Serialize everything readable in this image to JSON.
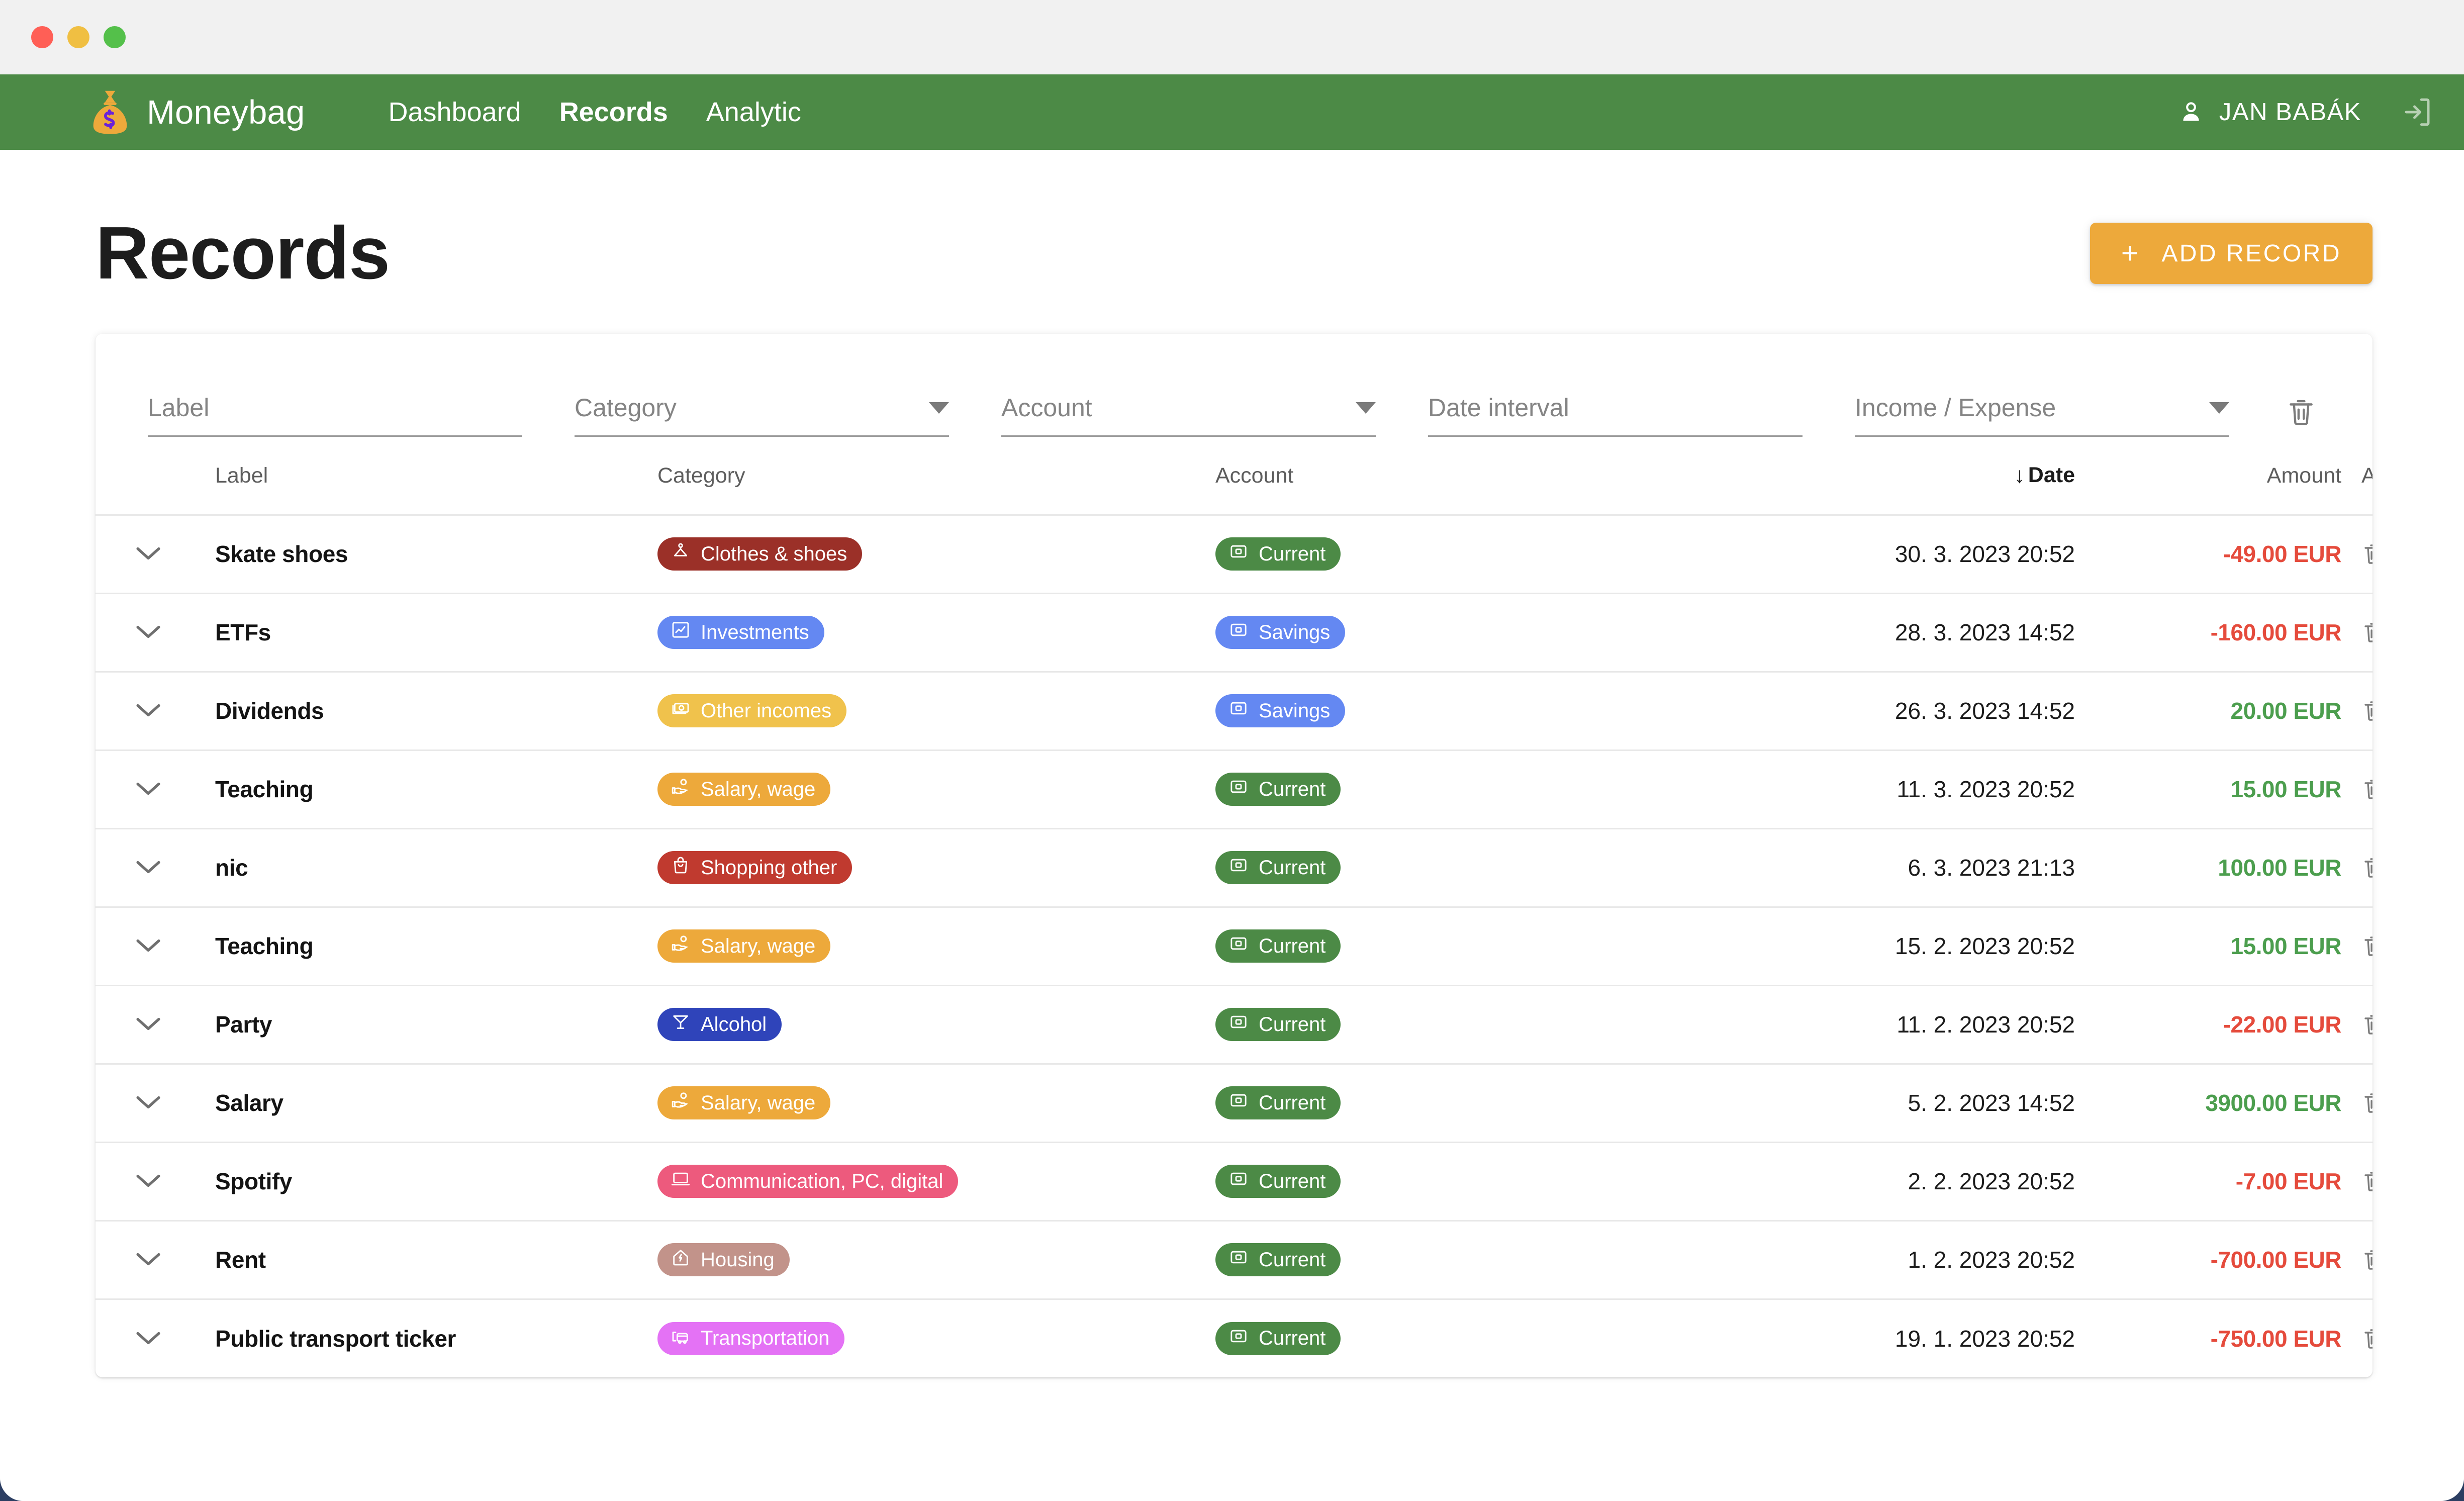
{
  "window": {
    "traffic_lights": [
      "close",
      "minimize",
      "maximize"
    ]
  },
  "navbar": {
    "brand": "Moneybag",
    "brand_icon": "moneybag-icon",
    "links": [
      {
        "label": "Dashboard",
        "active": false
      },
      {
        "label": "Records",
        "active": true
      },
      {
        "label": "Analytic",
        "active": false
      }
    ],
    "user_name": "JAN BABÁK",
    "user_icon": "person-icon",
    "logout_icon": "logout-icon",
    "background": "#4c8a46"
  },
  "page": {
    "title": "Records",
    "add_button": {
      "label": "ADD RECORD",
      "icon": "plus-icon",
      "color": "#eda93b"
    }
  },
  "filters": [
    {
      "name": "label",
      "placeholder": "Label",
      "type": "text",
      "value": ""
    },
    {
      "name": "category",
      "placeholder": "Category",
      "type": "select",
      "value": ""
    },
    {
      "name": "account",
      "placeholder": "Account",
      "type": "select",
      "value": ""
    },
    {
      "name": "date",
      "placeholder": "Date interval",
      "type": "text",
      "value": ""
    },
    {
      "name": "income_expense",
      "placeholder": "Income / Expense",
      "type": "select",
      "value": ""
    }
  ],
  "filters_clear_icon": "trash-icon",
  "table": {
    "columns": [
      "Label",
      "Category",
      "Account",
      "Date",
      "Amount",
      "Actions"
    ],
    "sort": {
      "column": "Date",
      "direction": "desc",
      "indicator": "↓"
    },
    "rows": [
      {
        "label": "Skate shoes",
        "category": "Clothes & shoes",
        "category_color": "#9b3028",
        "category_icon": "hanger-icon",
        "account": "Current",
        "account_color": "#4c8a46",
        "account_icon": "card-icon",
        "date": "30. 3. 2023 20:52",
        "amount": "-49.00 EUR",
        "amount_sign": "neg"
      },
      {
        "label": "ETFs",
        "category": "Investments",
        "category_color": "#6488f2",
        "category_icon": "chart-icon",
        "account": "Savings",
        "account_color": "#6488f2",
        "account_icon": "card-icon",
        "date": "28. 3. 2023 14:52",
        "amount": "-160.00 EUR",
        "amount_sign": "neg"
      },
      {
        "label": "Dividends",
        "category": "Other incomes",
        "category_color": "#f0c24c",
        "category_icon": "cash-icon",
        "account": "Savings",
        "account_color": "#6488f2",
        "account_icon": "card-icon",
        "date": "26. 3. 2023 14:52",
        "amount": "20.00 EUR",
        "amount_sign": "pos"
      },
      {
        "label": "Teaching",
        "category": "Salary, wage",
        "category_color": "#eda93b",
        "category_icon": "hand-coin-icon",
        "account": "Current",
        "account_color": "#4c8a46",
        "account_icon": "card-icon",
        "date": "11. 3. 2023 20:52",
        "amount": "15.00 EUR",
        "amount_sign": "pos"
      },
      {
        "label": "nic",
        "category": "Shopping other",
        "category_color": "#c03a2f",
        "category_icon": "bag-icon",
        "account": "Current",
        "account_color": "#4c8a46",
        "account_icon": "card-icon",
        "date": "6. 3. 2023 21:13",
        "amount": "100.00 EUR",
        "amount_sign": "pos"
      },
      {
        "label": "Teaching",
        "category": "Salary, wage",
        "category_color": "#eda93b",
        "category_icon": "hand-coin-icon",
        "account": "Current",
        "account_color": "#4c8a46",
        "account_icon": "card-icon",
        "date": "15. 2. 2023 20:52",
        "amount": "15.00 EUR",
        "amount_sign": "pos"
      },
      {
        "label": "Party",
        "category": "Alcohol",
        "category_color": "#2f44ba",
        "category_icon": "cocktail-icon",
        "account": "Current",
        "account_color": "#4c8a46",
        "account_icon": "card-icon",
        "date": "11. 2. 2023 20:52",
        "amount": "-22.00 EUR",
        "amount_sign": "neg"
      },
      {
        "label": "Salary",
        "category": "Salary, wage",
        "category_color": "#eda93b",
        "category_icon": "hand-coin-icon",
        "account": "Current",
        "account_color": "#4c8a46",
        "account_icon": "card-icon",
        "date": "5. 2. 2023 14:52",
        "amount": "3900.00 EUR",
        "amount_sign": "pos"
      },
      {
        "label": "Spotify",
        "category": "Communication, PC, digital",
        "category_color": "#ed5a7d",
        "category_icon": "laptop-icon",
        "account": "Current",
        "account_color": "#4c8a46",
        "account_icon": "card-icon",
        "date": "2. 2. 2023 20:52",
        "amount": "-7.00 EUR",
        "amount_sign": "neg"
      },
      {
        "label": "Rent",
        "category": "Housing",
        "category_color": "#c2938a",
        "category_icon": "house-icon",
        "account": "Current",
        "account_color": "#4c8a46",
        "account_icon": "card-icon",
        "date": "1. 2. 2023 20:52",
        "amount": "-700.00 EUR",
        "amount_sign": "neg"
      },
      {
        "label": "Public transport ticker",
        "category": "Transportation",
        "category_color": "#e472f5",
        "category_icon": "bus-icon",
        "account": "Current",
        "account_color": "#4c8a46",
        "account_icon": "card-icon",
        "date": "19. 1. 2023 20:52",
        "amount": "-750.00 EUR",
        "amount_sign": "neg"
      }
    ],
    "row_actions": {
      "delete_icon": "trash-icon",
      "edit_icon": "pencil-icon",
      "expand_icon": "chevron-down-icon"
    }
  },
  "colors": {
    "brand_green": "#4c8a46",
    "accent_orange": "#eda93b",
    "negative": "#e54b3c",
    "positive": "#4c9e4e"
  }
}
